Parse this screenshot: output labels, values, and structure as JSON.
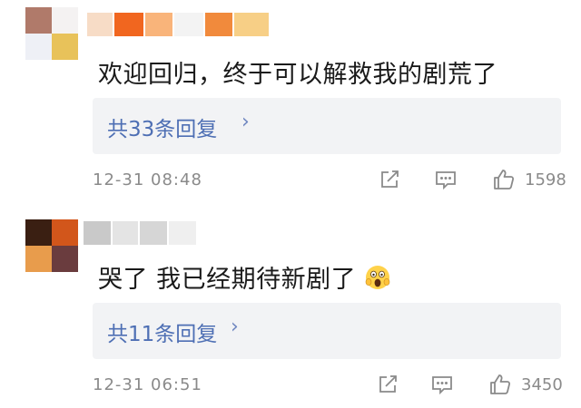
{
  "comments": [
    {
      "text": "欢迎回归，终于可以解救我的剧荒了",
      "reply_label": "共33条回复",
      "reply_chevron": "›",
      "timestamp": "12-31 08:48",
      "likes": "1598",
      "emoji": ""
    },
    {
      "text": "哭了 我已经期待新剧了",
      "reply_label": "共11条回复",
      "reply_chevron": "›",
      "timestamp": "12-31 06:51",
      "likes": "3450",
      "emoji": "scream-face-icon"
    }
  ],
  "colors": {
    "link": "#4e6fb4",
    "meta": "#8a8a8a",
    "reply_bg": "#f2f3f5",
    "text": "#1a1a1a"
  },
  "icons": [
    "repost-icon",
    "comment-icon",
    "like-icon"
  ]
}
